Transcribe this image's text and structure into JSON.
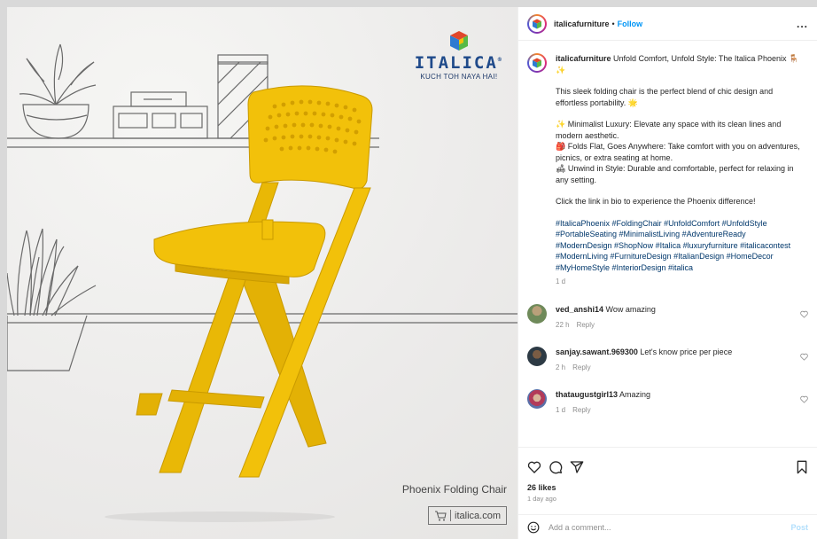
{
  "post": {
    "brand_name": "ITALICA",
    "brand_tagline": "KUCH TOH NAYA HAI!",
    "product_caption": "Phoenix Folding Chair",
    "website": "italica.com"
  },
  "header": {
    "username": "italicafurniture",
    "separator": "•",
    "follow_label": "Follow",
    "more_label": "..."
  },
  "caption": {
    "username": "italicafurniture",
    "title": "Unfold Comfort, Unfold Style: The Italica Phoenix 🪑✨",
    "intro": "This sleek folding chair is the perfect blend of chic design and effortless portability. 🌟",
    "bullet_1": "✨ Minimalist Luxury: Elevate any space with its clean lines and modern aesthetic.",
    "bullet_2": "🎒 Folds Flat, Goes Anywhere: Take comfort with you on adventures, picnics, or extra seating at home.",
    "bullet_3": "🛋 Unwind in Style: Durable and comfortable, perfect for relaxing in any setting.",
    "cta": "Click the link in bio to experience the Phoenix difference!",
    "hashtags": "#ItalicaPhoenix #FoldingChair #UnfoldComfort #UnfoldStyle #PortableSeating #MinimalistLiving #AdventureReady #ModernDesign #ShopNow #Italica #luxuryfurniture #italicacontest #ModernLiving #FurnitureDesign #ItalianDesign #HomeDecor #MyHomeStyle #InteriorDesign #italica",
    "age": "1 d"
  },
  "comments": [
    {
      "username": "ved_anshi14",
      "text": "Wow amazing",
      "age": "22 h",
      "reply": "Reply"
    },
    {
      "username": "sanjay.sawant.969300",
      "text": "Let's know price per piece",
      "age": "2 h",
      "reply": "Reply"
    },
    {
      "username": "thataugustgirl13",
      "text": "Amazing",
      "age": "1 d",
      "reply": "Reply"
    }
  ],
  "footer": {
    "likes": "26 likes",
    "posted": "1 day ago",
    "add_comment_placeholder": "Add a comment...",
    "post_label": "Post"
  },
  "colors": {
    "chair": "#f2c10a",
    "link": "#00376b",
    "follow": "#0095f6"
  }
}
